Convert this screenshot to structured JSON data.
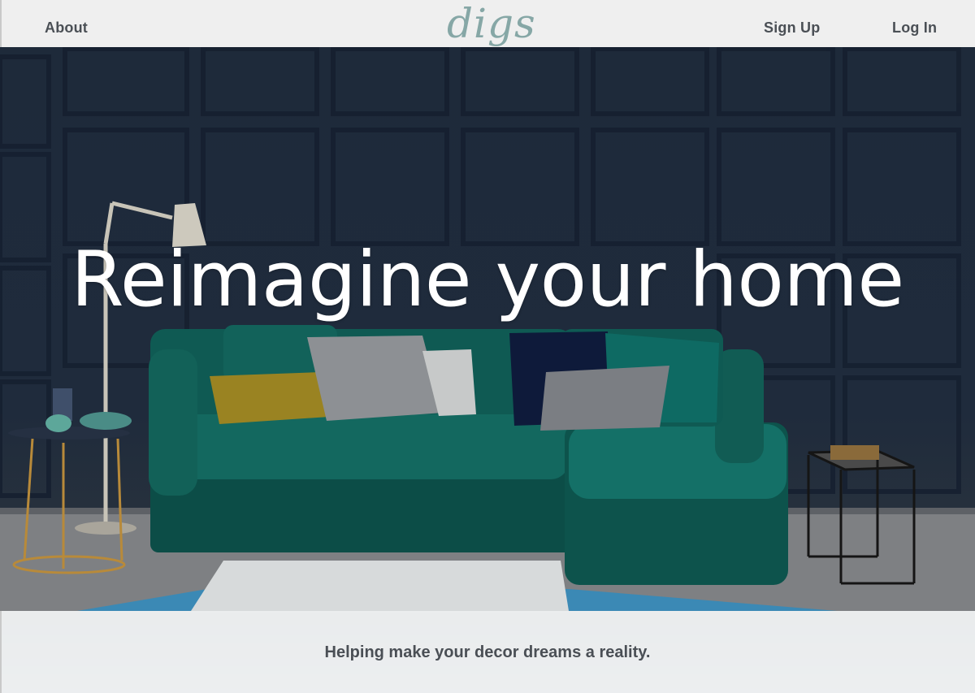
{
  "nav": {
    "about": "About",
    "logo": "digs",
    "sign_up": "Sign Up",
    "log_in": "Log In"
  },
  "hero": {
    "headline": "Reimagine your home",
    "tagline": "Helping make your decor dreams a reality."
  },
  "colors": {
    "nav_bg": "#efefef",
    "nav_text": "#4a4f55",
    "logo": "#86a7a6",
    "wall": "#1e2a3a",
    "sofa": "#0f5a53",
    "headline": "#ffffff"
  }
}
